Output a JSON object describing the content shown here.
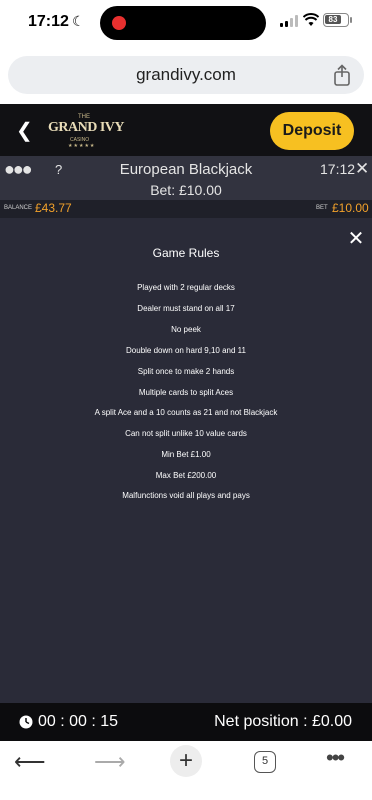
{
  "status_bar": {
    "time": "17:12",
    "battery": "83"
  },
  "browser": {
    "url": "grandivy.com",
    "tab_count": "5"
  },
  "header": {
    "logo_the": "THE",
    "logo_main": "GRAND IVY",
    "logo_sub": "CASINO",
    "logo_stars": "★★★★★",
    "deposit_label": "Deposit"
  },
  "game": {
    "title": "European Blackjack",
    "bet_line": "Bet: £10.00",
    "time": "17:12",
    "help": "?"
  },
  "balance_bar": {
    "balance_label": "BALANCE",
    "balance_value": "£43.77",
    "bet_label": "BET",
    "bet_value": "£10.00"
  },
  "rules": {
    "title": "Game Rules",
    "items": [
      "Played with 2 regular decks",
      "Dealer must stand on all 17",
      "No peek",
      "Double down on hard 9,10 and 11",
      "Split once to make 2 hands",
      "Multiple cards to split Aces",
      "A split Ace and a 10 counts as 21 and not Blackjack",
      "Can not split unlike 10 value cards",
      "Min Bet £1.00",
      "Max Bet £200.00",
      "Malfunctions void all plays and pays"
    ]
  },
  "info_bar": {
    "session_time": "00 : 00 : 15",
    "net_position": "Net position : £0.00"
  },
  "colors": {
    "accent_yellow": "#f7c021",
    "balance_orange": "#f2a12a",
    "record_red": "#e8302f"
  }
}
